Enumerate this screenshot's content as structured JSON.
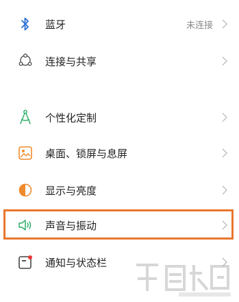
{
  "settings": {
    "bluetooth": {
      "label": "蓝牙",
      "value": "未连接"
    },
    "connection": {
      "label": "连接与共享"
    },
    "personalize": {
      "label": "个性化定制"
    },
    "desktop": {
      "label": "桌面、锁屏与息屏"
    },
    "display": {
      "label": "显示与亮度"
    },
    "sound": {
      "label": "声音与振动"
    },
    "notification": {
      "label": "通知与状态栏"
    }
  },
  "colors": {
    "accent_green": "#2fae6a",
    "accent_orange": "#f08a2c",
    "icon_blue": "#2a6fd6",
    "highlight_border": "#e8772e"
  }
}
